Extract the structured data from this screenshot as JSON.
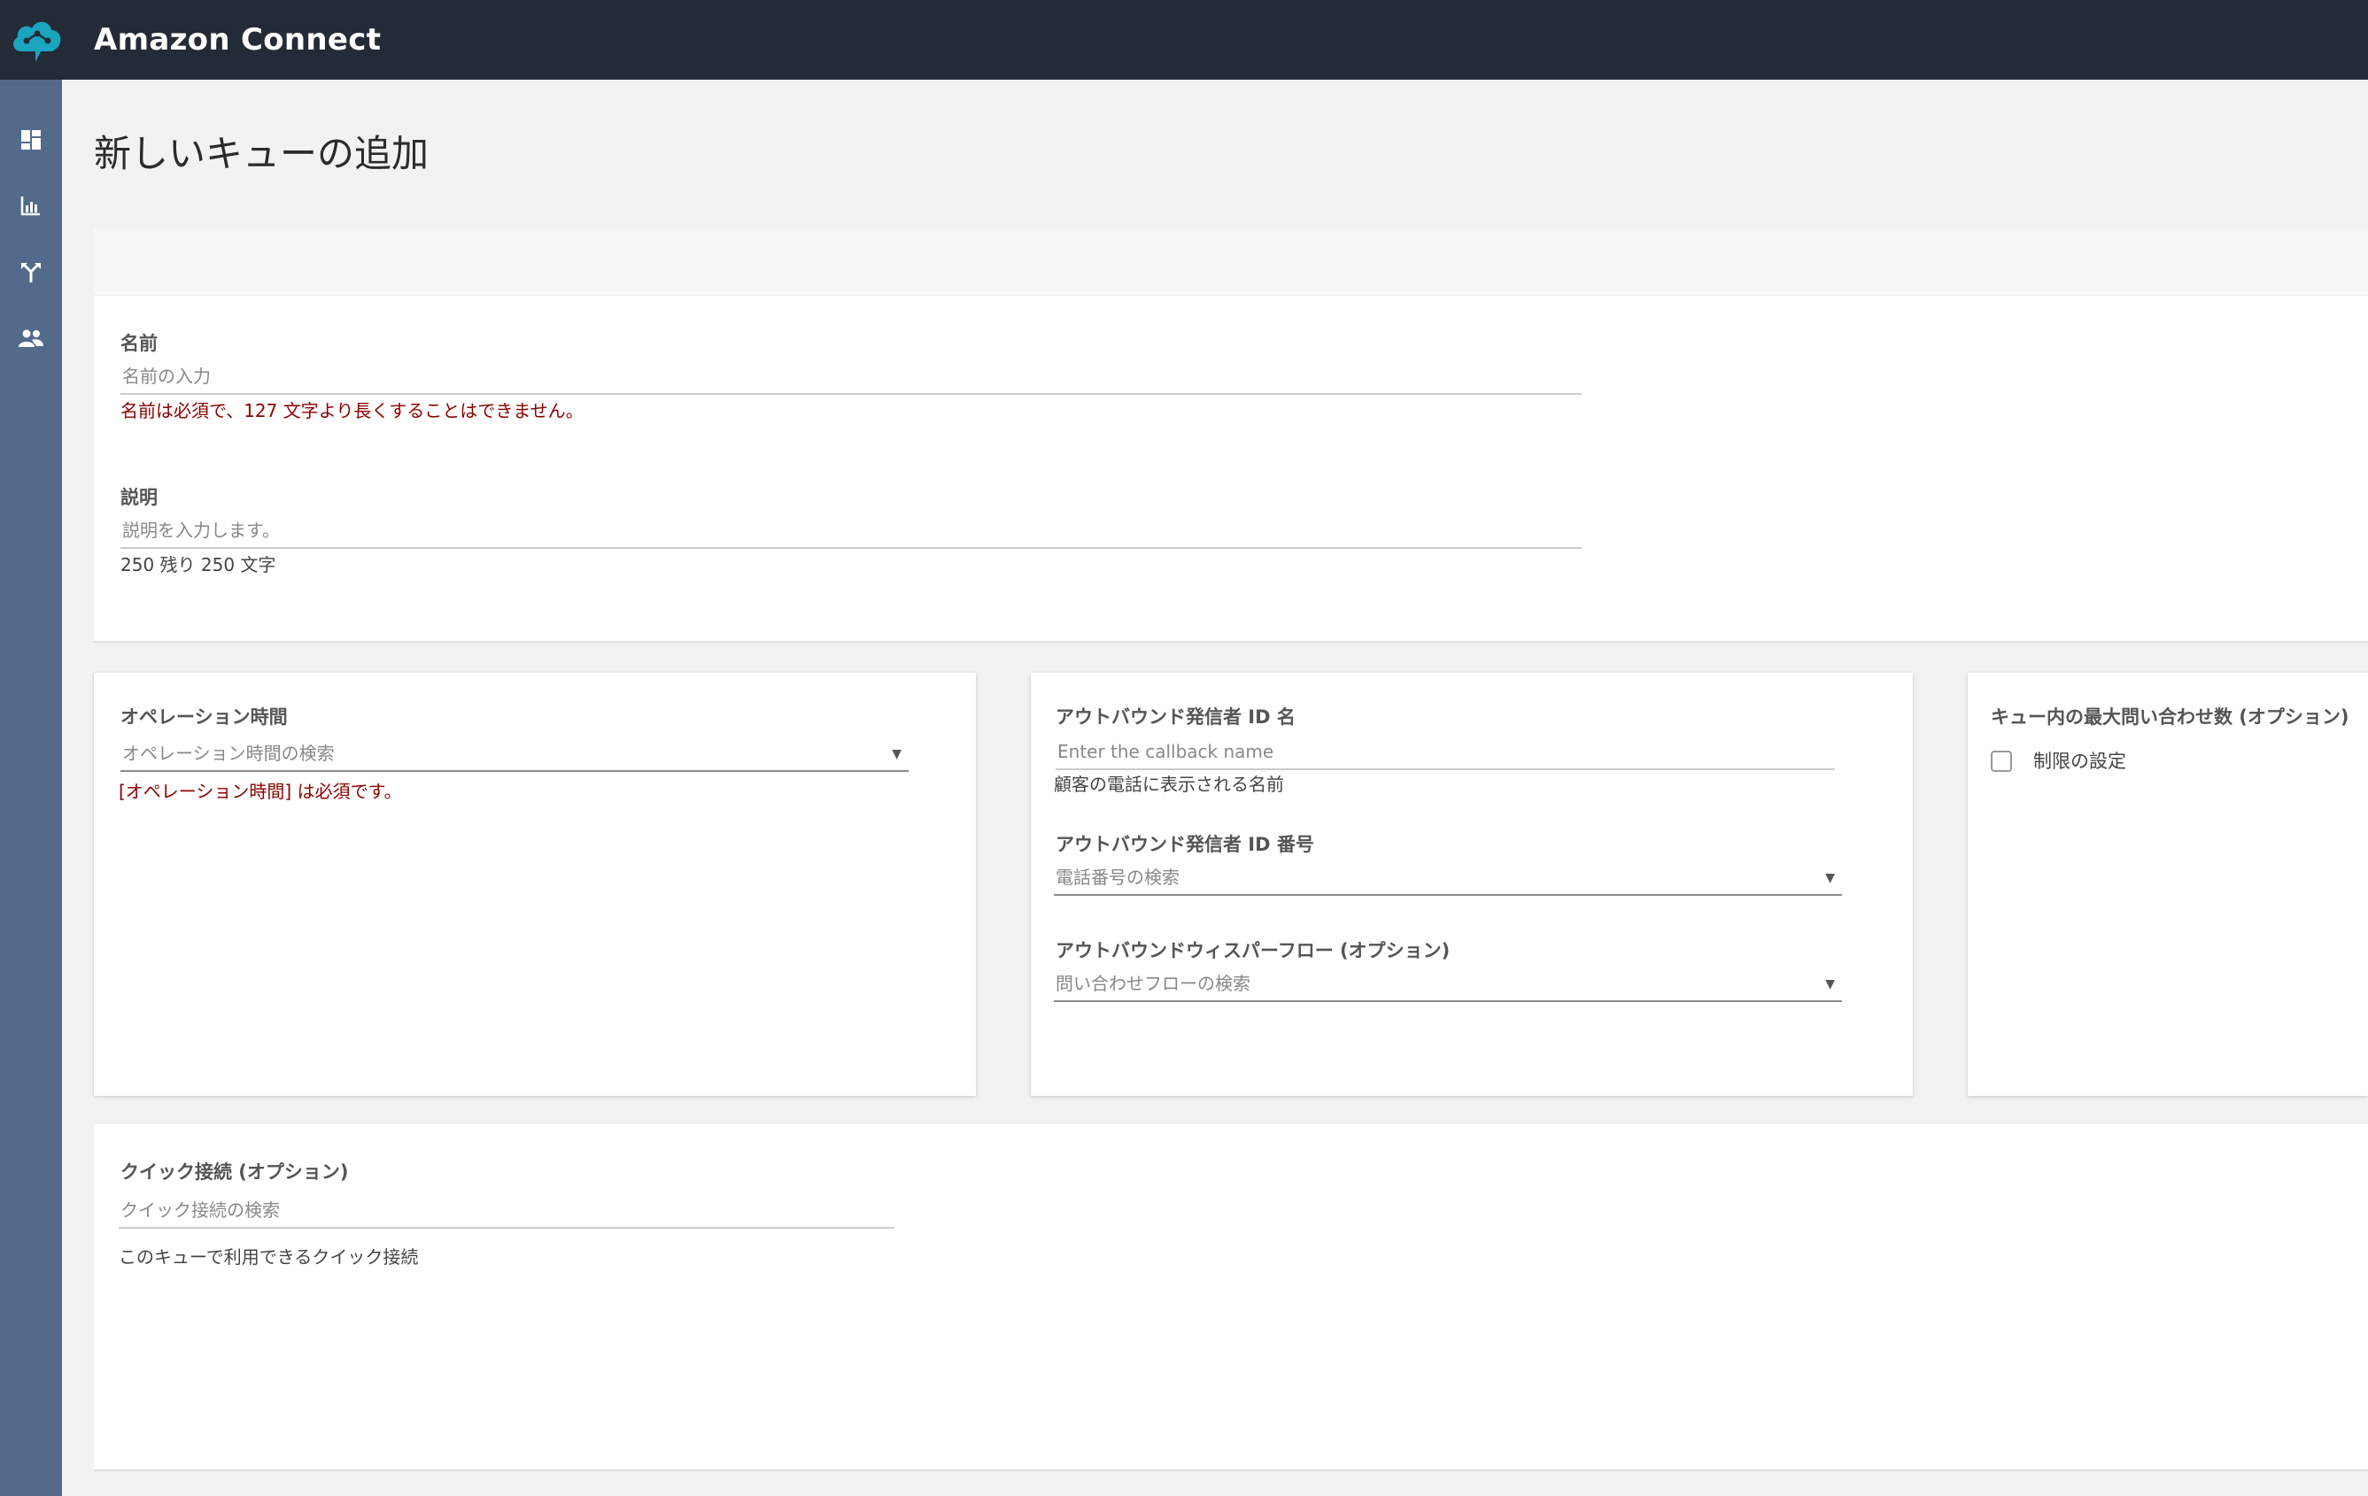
{
  "header": {
    "app_title": "Amazon Connect",
    "logo_icon": "amazon-connect-cloud-logo",
    "bg_color": "#232b37"
  },
  "sidebar": {
    "bg_color": "#536a8a",
    "items": [
      {
        "icon": "dashboard-icon"
      },
      {
        "icon": "metrics-chart-icon"
      },
      {
        "icon": "routing-icon"
      },
      {
        "icon": "users-icon"
      }
    ]
  },
  "page": {
    "title": "新しいキューの追加"
  },
  "name_section": {
    "name_label": "名前",
    "name_placeholder": "名前の入力",
    "name_error": "名前は必須で、127 文字より長くすることはできません。",
    "description_label": "説明",
    "description_placeholder": "説明を入力します。",
    "description_helper": "250 残り 250 文字"
  },
  "hours_panel": {
    "label": "オペレーション時間",
    "placeholder": "オペレーション時間の検索",
    "error": "[オペレーション時間] は必須です。"
  },
  "outbound_panel": {
    "caller_id_name_label": "アウトバウンド発信者 ID 名",
    "caller_id_name_placeholder": "Enter the callback name",
    "caller_id_name_helper": "顧客の電話に表示される名前",
    "caller_id_number_label": "アウトバウンド発信者 ID 番号",
    "caller_id_number_placeholder": "電話番号の検索",
    "whisper_flow_label": "アウトバウンドウィスパーフロー (オプション)",
    "whisper_flow_placeholder": "問い合わせフローの検索"
  },
  "max_contacts_panel": {
    "label": "キュー内の最大問い合わせ数 (オプション)",
    "checkbox_label": "制限の設定",
    "checked": false
  },
  "quick_connect_panel": {
    "label": "クイック接続 (オプション)",
    "placeholder": "クイック接続の検索",
    "helper": "このキューで利用できるクイック接続"
  }
}
